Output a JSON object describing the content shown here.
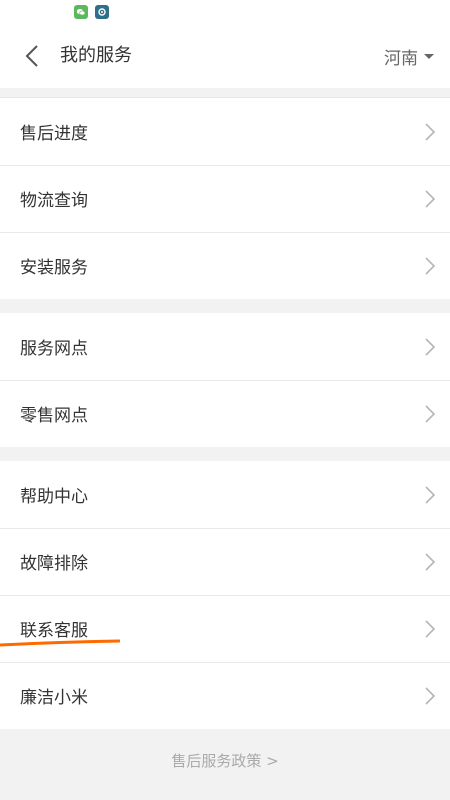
{
  "status_bar": {
    "icons": [
      "wechat-icon",
      "app-notification-icon"
    ]
  },
  "header": {
    "title": "我的服务",
    "region": "河南"
  },
  "groups": [
    {
      "items": [
        {
          "label": "售后进度"
        },
        {
          "label": "物流查询"
        },
        {
          "label": "安装服务"
        }
      ]
    },
    {
      "items": [
        {
          "label": "服务网点"
        },
        {
          "label": "零售网点"
        }
      ]
    },
    {
      "items": [
        {
          "label": "帮助中心"
        },
        {
          "label": "故障排除"
        },
        {
          "label": "联系客服"
        },
        {
          "label": "廉洁小米"
        }
      ]
    }
  ],
  "footer": {
    "policy_link": "售后服务政策 >"
  },
  "colors": {
    "background": "#f2f2f2",
    "card": "#ffffff",
    "text": "#333333",
    "muted": "#aaaaaa",
    "highlight": "#ff6a00"
  }
}
